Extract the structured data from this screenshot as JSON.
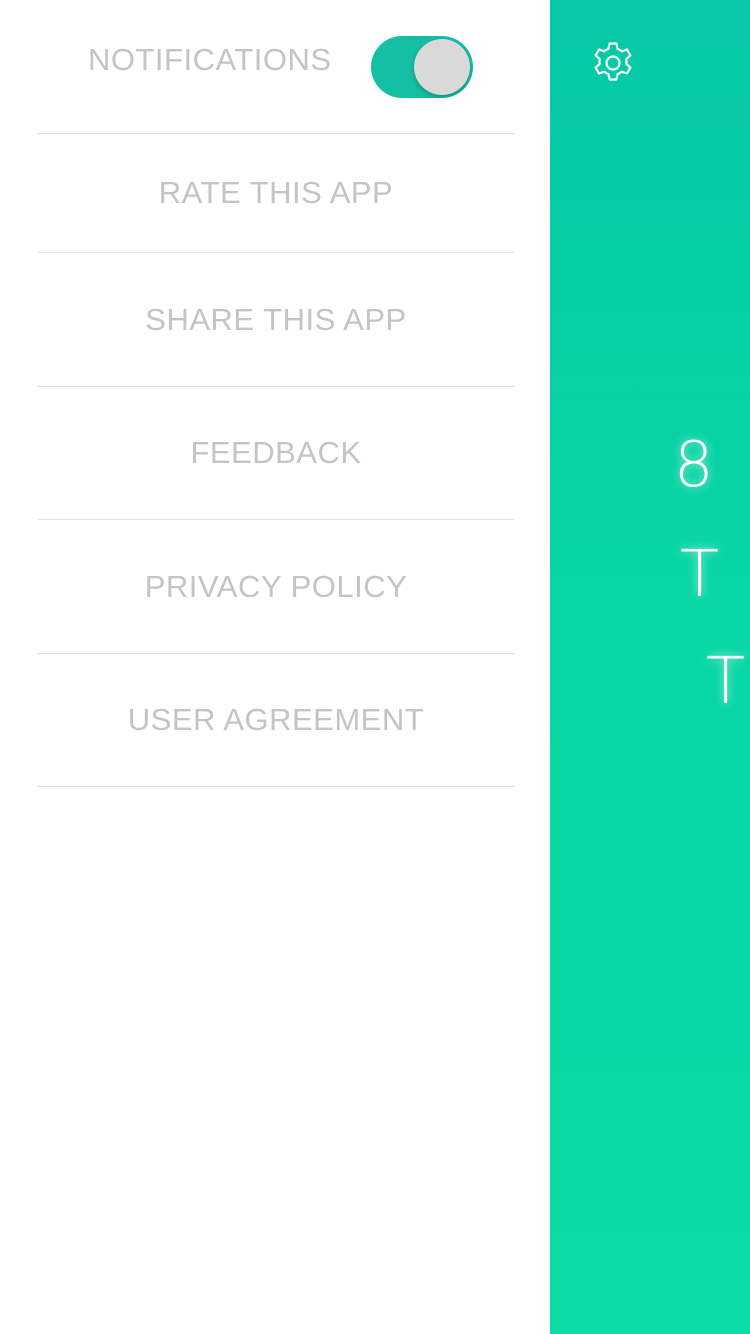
{
  "drawer": {
    "notifications": {
      "label": "NOTIFICATIONS",
      "enabled": true
    },
    "items": [
      {
        "label": "RATE THIS APP"
      },
      {
        "label": "SHARE THIS APP"
      },
      {
        "label": "FEEDBACK"
      },
      {
        "label": "PRIVACY POLICY"
      },
      {
        "label": "USER AGREEMENT"
      }
    ]
  },
  "main": {
    "settings_icon": "gear-icon",
    "visible_text": {
      "line1": "8",
      "line2": "T (",
      "line3": "T"
    }
  },
  "colors": {
    "accent": "#14bfa3",
    "panel_top": "#05c8a6",
    "panel_bottom": "#0bdaa4",
    "menu_text": "#c4c4c4",
    "divider": "#e2e2e2"
  }
}
